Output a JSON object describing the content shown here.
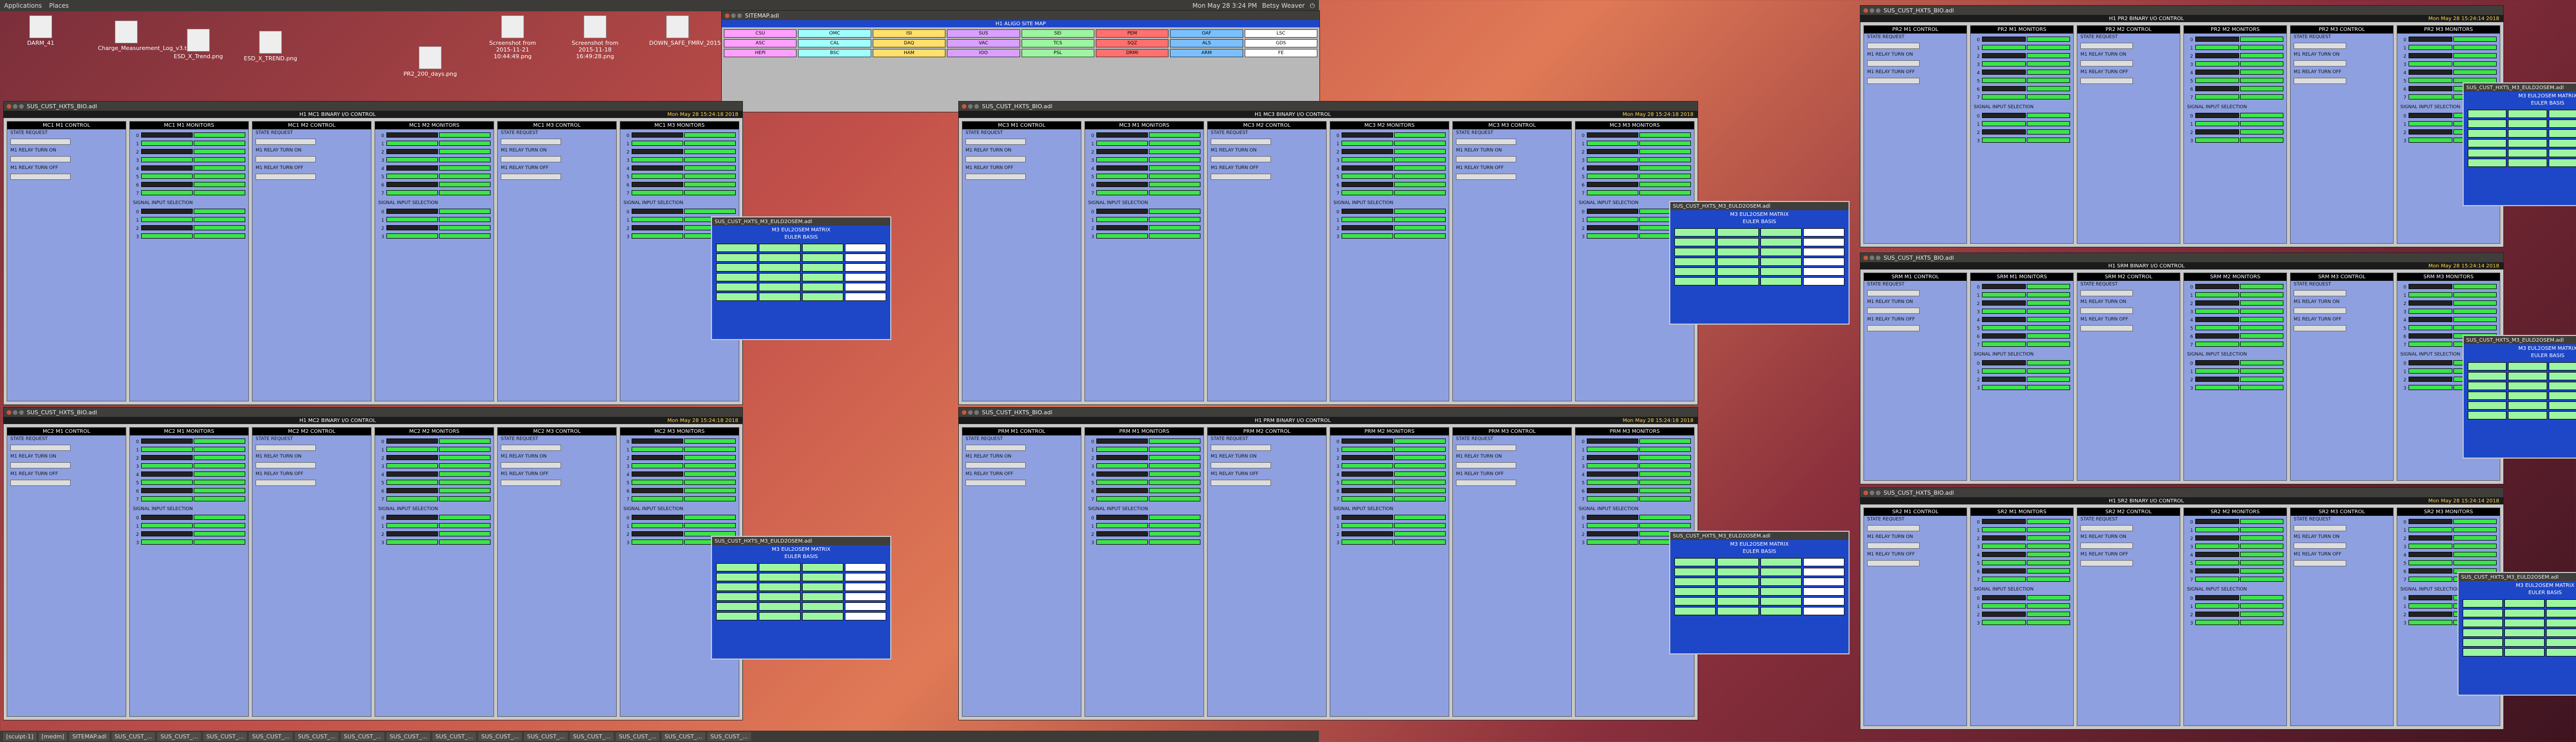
{
  "top_menu": {
    "apps": "Applications",
    "places": "Places",
    "clock": "Mon May 28 3:24 PM",
    "user": "Betsy Weaver"
  },
  "desktop_icons": [
    {
      "label": "DARM_41"
    },
    {
      "label": "Charge_Measurement_Log_v3.txt"
    },
    {
      "label": "ESD_X_Trend.png"
    },
    {
      "label": "ESD_X_TREND.png"
    },
    {
      "label": "PR2_200_days.png"
    },
    {
      "label": "Screenshot from 2015-11-21 10:44:49.png"
    },
    {
      "label": "Screenshot from 2015-11-18 16:49:28.png"
    },
    {
      "label": "DOWN_SAFE_FMRV_2015.png"
    }
  ],
  "sitemap": {
    "title": "SITEMAP.adl",
    "header": "H1 ALIGO SITE MAP",
    "cells": [
      "CSU",
      "OMC",
      "ISI",
      "SUS",
      "SEI",
      "PEM",
      "OAF",
      "LSC",
      "ASC",
      "CAL",
      "DAQ",
      "VAC",
      "TCS",
      "SQZ",
      "ALS",
      "GDS",
      "HEPI",
      "BSC",
      "HAM",
      "IOO",
      "PSL",
      "DRMI",
      "ARM",
      "FE"
    ]
  },
  "windows": [
    {
      "title": "SUS_CUST_HXTS_BIO.adl",
      "header": "H1 MC1 BINARY I/O CONTROL",
      "date": "Mon May 28 15:24:18 2018",
      "p1": "MC1 M1 CONTROL",
      "p2": "MC1 M1 MONITORS",
      "p3": "MC1 M2 CONTROL",
      "p4": "MC1 M2 MONITORS",
      "p5": "MC1 M3 CONTROL",
      "p6": "MC1 M3 MONITORS"
    },
    {
      "title": "SUS_CUST_HXTS_BIO.adl",
      "header": "H1 MC3 BINARY I/O CONTROL",
      "date": "Mon May 28 15:24:18 2018",
      "p1": "MC3 M1 CONTROL",
      "p2": "MC3 M1 MONITORS",
      "p3": "MC3 M2 CONTROL",
      "p4": "MC3 M2 MONITORS",
      "p5": "MC3 M3 CONTROL",
      "p6": "MC3 M3 MONITORS"
    },
    {
      "title": "SUS_CUST_HXTS_BIO.adl",
      "header": "H1 MC2 BINARY I/O CONTROL",
      "date": "Mon May 28 15:24:18 2018",
      "p1": "MC2 M1 CONTROL",
      "p2": "MC2 M1 MONITORS",
      "p3": "MC2 M2 CONTROL",
      "p4": "MC2 M2 MONITORS",
      "p5": "MC2 M3 CONTROL",
      "p6": "MC2 M3 MONITORS"
    },
    {
      "title": "SUS_CUST_HXTS_BIO.adl",
      "header": "H1 PRM BINARY I/O CONTROL",
      "date": "Mon May 28 15:24:18 2018",
      "p1": "PRM M1 CONTROL",
      "p2": "PRM M1 MONITORS",
      "p3": "PRM M2 CONTROL",
      "p4": "PRM M2 MONITORS",
      "p5": "PRM M3 CONTROL",
      "p6": "PRM M3 MONITORS"
    },
    {
      "title": "SUS_CUST_HXTS_BIO.adl",
      "header": "H1 PR2 BINARY I/O CONTROL",
      "date": "Mon May 28 15:24:14 2018",
      "p1": "PR2 M1 CONTROL",
      "p2": "PR2 M1 MONITORS",
      "p3": "PR2 M2 CONTROL",
      "p4": "PR2 M2 MONITORS",
      "p5": "PR2 M3 CONTROL",
      "p6": "PR2 M3 MONITORS"
    },
    {
      "title": "SUS_CUST_HXTS_BIO.adl",
      "header": "H1 SRM BINARY I/O CONTROL",
      "date": "Mon May 28 15:24:14 2018",
      "p1": "SRM M1 CONTROL",
      "p2": "SRM M1 MONITORS",
      "p3": "SRM M2 CONTROL",
      "p4": "SRM M2 MONITORS",
      "p5": "SRM M3 CONTROL",
      "p6": "SRM M3 MONITORS"
    },
    {
      "title": "SUS_CUST_HXTS_BIO.adl",
      "header": "H1 SR2 BINARY I/O CONTROL",
      "date": "Mon May 28 15:24:14 2018",
      "p1": "SR2 M1 CONTROL",
      "p2": "SR2 M1 MONITORS",
      "p3": "SR2 M2 CONTROL",
      "p4": "SR2 M2 MONITORS",
      "p5": "SR2 M3 CONTROL",
      "p6": "SR2 M3 MONITORS"
    }
  ],
  "popups": [
    {
      "title": "SUS_CUST_HXTS_M3_EULD2OSEM.adl",
      "header": "M3 EUL2OSEM MATRIX",
      "sub": "EULER BASIS"
    },
    {
      "title": "SUS_CUST_HXTS_M3_EULD2OSEM.adl",
      "header": "M3 EUL2OSEM MATRIX",
      "sub": "EULER BASIS"
    },
    {
      "title": "SUS_CUST_HXTS_M3_EULD2OSEM.adl",
      "header": "M3 EUL2OSEM MATRIX",
      "sub": "EULER BASIS"
    },
    {
      "title": "SUS_CUST_HXTS_M3_EULD2OSEM.adl",
      "header": "M3 EUL2OSEM MATRIX",
      "sub": "EULER BASIS"
    },
    {
      "title": "SUS_CUST_HXTS_M3_EULD2OSEM.adl",
      "header": "M3 EUL2OSEM MATRIX",
      "sub": "EULER BASIS"
    },
    {
      "title": "SUS_CUST_HXTS_M3_EULD2OSEM.adl",
      "header": "M3 EUL2OSEM MATRIX",
      "sub": "EULER BASIS"
    },
    {
      "title": "SUS_CUST_HXTS_M3_EULD2OSEM.adl",
      "header": "M3 EUL2OSEM MATRIX",
      "sub": "EULER BASIS"
    }
  ],
  "panel_labels": {
    "state_request": "STATE REQUEST",
    "relay_on": "M1 RELAY TURN ON",
    "relay_off": "M1 RELAY TURN OFF",
    "signal_select": "SIGNAL INPUT SELECTION",
    "switch": "SWITCH"
  },
  "taskbar": [
    "[sculpt-1]",
    "[medm]",
    "SITEMAP.adl",
    "SUS_CUST_...",
    "SUS_CUST_...",
    "SUS_CUST_...",
    "SUS_CUST_...",
    "SUS_CUST_...",
    "SUS_CUST_...",
    "SUS_CUST_...",
    "SUS_CUST_...",
    "SUS_CUST_...",
    "SUS_CUST_...",
    "SUS_CUST_...",
    "SUS_CUST_...",
    "SUS_CUST_...",
    "SUS_CUST_..."
  ]
}
